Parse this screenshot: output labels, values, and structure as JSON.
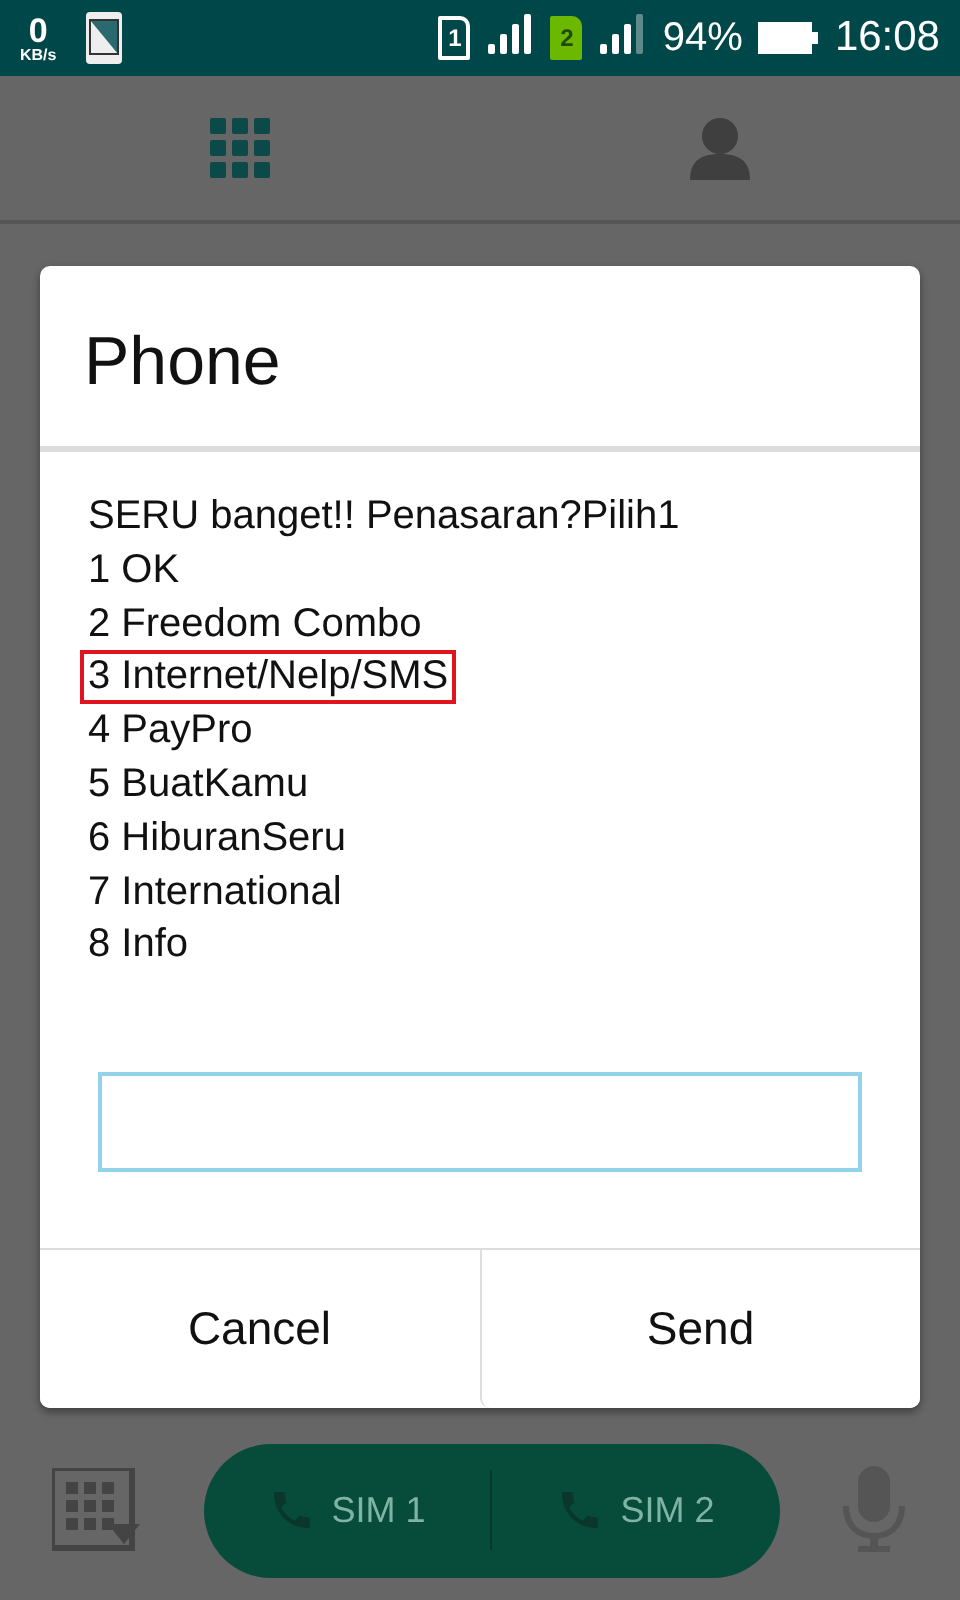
{
  "status_bar": {
    "speed_value": "0",
    "speed_unit": "KB/s",
    "sims": [
      {
        "label": "1",
        "active": false
      },
      {
        "label": "2",
        "active": true
      }
    ],
    "battery": "94%",
    "time": "16:08"
  },
  "dialer": {
    "call_buttons": [
      "SIM 1",
      "SIM 2"
    ]
  },
  "dialog": {
    "title": "Phone",
    "lines": [
      {
        "text": "SERU banget!! Penasaran?Pilih1",
        "highlighted": false
      },
      {
        "text": "1 OK",
        "highlighted": false
      },
      {
        "text": "2 Freedom Combo",
        "highlighted": false
      },
      {
        "text": "3 Internet/Nelp/SMS",
        "highlighted": true
      },
      {
        "text": "4 PayPro",
        "highlighted": false
      },
      {
        "text": "5 BuatKamu",
        "highlighted": false
      },
      {
        "text": "6 HiburanSeru",
        "highlighted": false
      },
      {
        "text": "7 International",
        "highlighted": false
      },
      {
        "text": "8 Info",
        "highlighted": false
      }
    ],
    "buttons": [
      "Cancel",
      "Send"
    ]
  }
}
